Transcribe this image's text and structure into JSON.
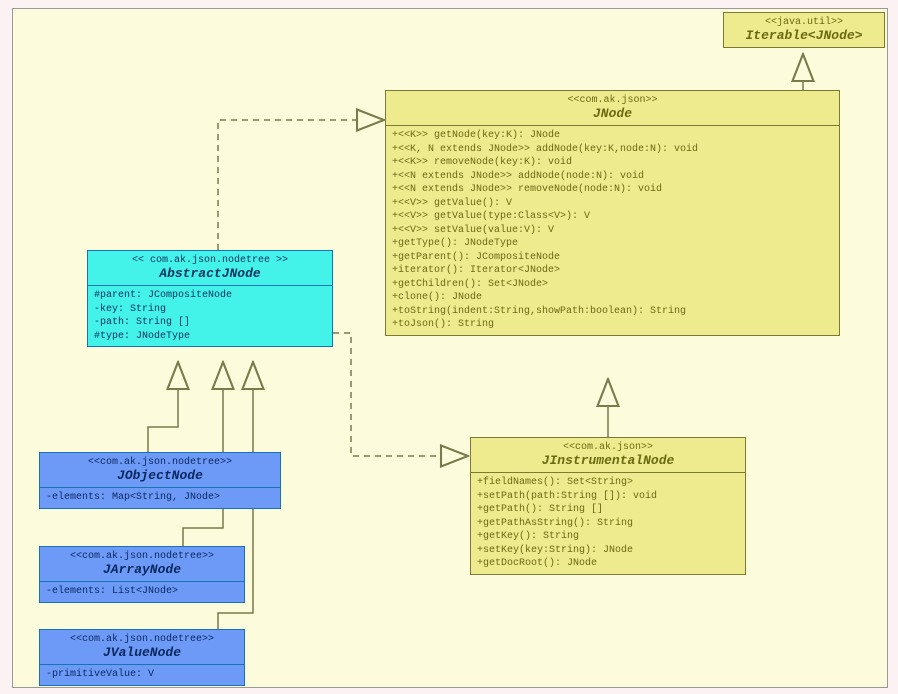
{
  "iterable": {
    "stereotype": "<<java.util>>",
    "name": "Iterable<JNode>"
  },
  "jnode": {
    "stereotype": "<<com.ak.json>>",
    "name": "JNode",
    "methods": "+<<K>> getNode(key:K): JNode\n+<<K, N extends JNode>> addNode(key:K,node:N): void\n+<<K>> removeNode(key:K): void\n+<<N extends JNode>> addNode(node:N): void\n+<<N extends JNode>> removeNode(node:N): void\n+<<V>> getValue(): V\n+<<V>> getValue(type:Class<V>): V\n+<<V>> setValue(value:V): V\n+getType(): JNodeType\n+getParent(): JCompositeNode\n+iterator(): Iterator<JNode>\n+getChildren(): Set<JNode>\n+clone(): JNode\n+toString(indent:String,showPath:boolean): String\n+toJson(): String"
  },
  "jinstrumental": {
    "stereotype": "<<com.ak.json>>",
    "name": "JInstrumentalNode",
    "methods": "+fieldNames(): Set<String>\n+setPath(path:String []): void\n+getPath(): String []\n+getPathAsString(): String\n+getKey(): String\n+setKey(key:String): JNode\n+getDocRoot(): JNode"
  },
  "abstract": {
    "stereotype": "<<  com.ak.json.nodetree  >>",
    "name": "AbstractJNode",
    "attrs": "#parent: JCompositeNode\n-key: String\n-path: String []\n#type: JNodeType"
  },
  "jobject": {
    "stereotype": "<<com.ak.json.nodetree>>",
    "name": "JObjectNode",
    "attrs": "-elements: Map<String, JNode>"
  },
  "jarray": {
    "stereotype": "<<com.ak.json.nodetree>>",
    "name": "JArrayNode",
    "attrs": "-elements: List<JNode>"
  },
  "jvalue": {
    "stereotype": "<<com.ak.json.nodetree>>",
    "name": "JValueNode",
    "attrs": "-primitiveValue: V"
  }
}
